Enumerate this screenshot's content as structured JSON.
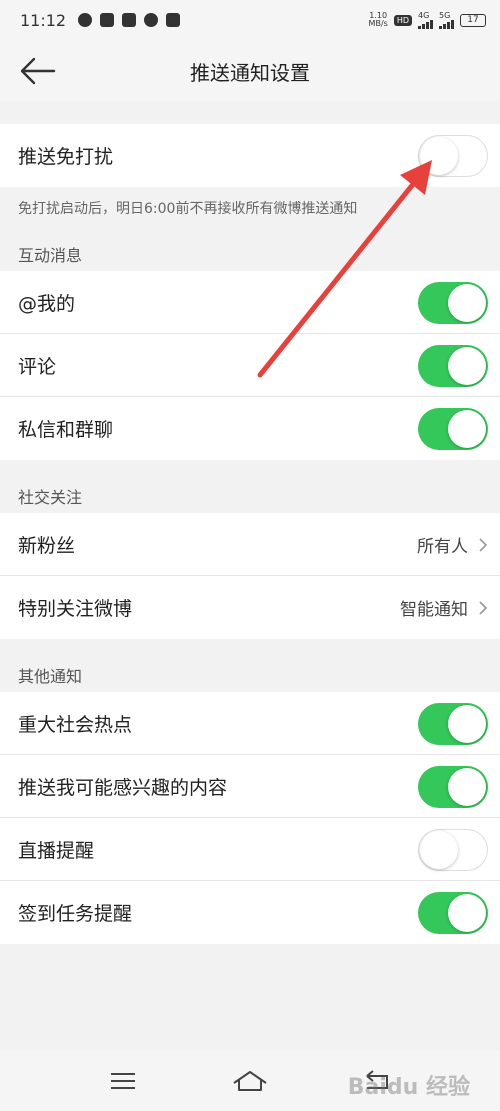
{
  "status_bar": {
    "time": "11:12",
    "net_speed_value": "1.10",
    "net_speed_unit": "MB/s",
    "hd": "HD",
    "sig1": "4G",
    "sig2": "5G",
    "battery": "17",
    "app_icons": [
      "weibo-icon",
      "security-icon",
      "app-icon",
      "browser-icon",
      "telegram-icon"
    ]
  },
  "header": {
    "title": "推送通知设置"
  },
  "dnd": {
    "label": "推送免打扰",
    "on": false,
    "hint": "免打扰启动后，明日6:00前不再接收所有微博推送通知"
  },
  "sections": {
    "interaction": {
      "title": "互动消息",
      "items": [
        {
          "label": "@我的",
          "on": true
        },
        {
          "label": "评论",
          "on": true
        },
        {
          "label": "私信和群聊",
          "on": true
        }
      ]
    },
    "social": {
      "title": "社交关注",
      "items": [
        {
          "label": "新粉丝",
          "value": "所有人"
        },
        {
          "label": "特别关注微博",
          "value": "智能通知"
        }
      ]
    },
    "other": {
      "title": "其他通知",
      "items": [
        {
          "label": "重大社会热点",
          "on": true
        },
        {
          "label": "推送我可能感兴趣的内容",
          "on": true
        },
        {
          "label": "直播提醒",
          "on": false
        },
        {
          "label": "签到任务提醒",
          "on": true
        }
      ]
    }
  },
  "watermark": "Baidu 经验",
  "colors": {
    "toggle_on": "#34c759",
    "arrow": "#e8413c"
  }
}
